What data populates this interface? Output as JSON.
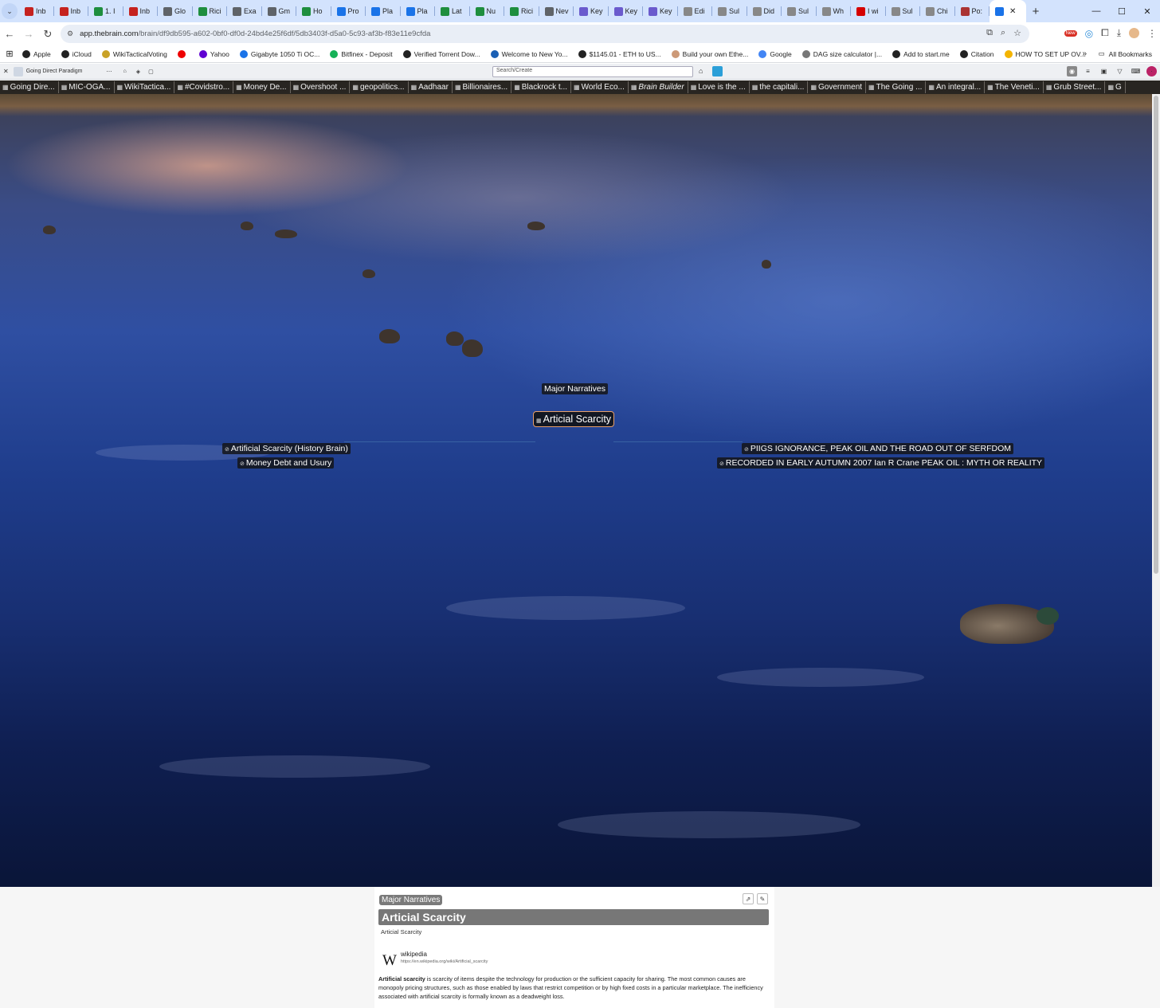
{
  "browser": {
    "tabs": [
      {
        "label": "Inb",
        "color": "#c5221f"
      },
      {
        "label": "Inb",
        "color": "#c5221f"
      },
      {
        "label": "1. I",
        "color": "#1e8e3e"
      },
      {
        "label": "Inb",
        "color": "#c5221f"
      },
      {
        "label": "Glo",
        "color": "#5f6368"
      },
      {
        "label": "Rici",
        "color": "#1e8e3e"
      },
      {
        "label": "Exa",
        "color": "#5f6368"
      },
      {
        "label": "Gm",
        "color": "#5f6368"
      },
      {
        "label": "Ho",
        "color": "#1e8e3e"
      },
      {
        "label": "Pro",
        "color": "#1a73e8"
      },
      {
        "label": "Pla",
        "color": "#1a73e8"
      },
      {
        "label": "Pla",
        "color": "#1a73e8"
      },
      {
        "label": "Lat",
        "color": "#1e8e3e"
      },
      {
        "label": "Nu",
        "color": "#1e8e3e"
      },
      {
        "label": "Rici",
        "color": "#1e8e3e"
      },
      {
        "label": "Nev",
        "color": "#5f6368"
      },
      {
        "label": "Key",
        "color": "#6a5acd"
      },
      {
        "label": "Key",
        "color": "#6a5acd"
      },
      {
        "label": "Key",
        "color": "#6a5acd"
      },
      {
        "label": "Edi",
        "color": "#888"
      },
      {
        "label": "Sul",
        "color": "#888"
      },
      {
        "label": "Did",
        "color": "#888"
      },
      {
        "label": "Sul",
        "color": "#888"
      },
      {
        "label": "Wh",
        "color": "#888"
      },
      {
        "label": "I wi",
        "color": "#d50000"
      },
      {
        "label": "Sul",
        "color": "#888"
      },
      {
        "label": "Chi",
        "color": "#888"
      },
      {
        "label": "Po:",
        "color": "#a33"
      }
    ],
    "active_tab": {
      "label": "✕"
    },
    "url": {
      "host": "app.thebrain.com",
      "path": "/brain/df9db595-a602-0bf0-df0d-24bd4e25f6df/5db3403f-d5a0-5c93-af3b-f83e11e9cfda"
    },
    "bookmarks": [
      {
        "label": "Apple",
        "color": "#222"
      },
      {
        "label": "iCloud",
        "color": "#222"
      },
      {
        "label": "WikiTacticalVoting",
        "color": "#c9a227"
      },
      {
        "label": "",
        "color": "#e00"
      },
      {
        "label": "Yahoo",
        "color": "#6001d2"
      },
      {
        "label": "Gigabyte 1050 Ti OC...",
        "color": "#1a73e8"
      },
      {
        "label": "Bitfinex - Deposit",
        "color": "#16b157"
      },
      {
        "label": "Verified Torrent Dow...",
        "color": "#222"
      },
      {
        "label": "Welcome to New Yo...",
        "color": "#1a5fb4"
      },
      {
        "label": "$1145.01 - ETH to US...",
        "color": "#222"
      },
      {
        "label": "Build your own Ethe...",
        "color": "#c97"
      },
      {
        "label": "Google",
        "color": "#4285f4"
      },
      {
        "label": "DAG size calculator |...",
        "color": "#777"
      },
      {
        "label": "Add to start.me",
        "color": "#222"
      },
      {
        "label": "Citation",
        "color": "#222"
      },
      {
        "label": "HOW TO SET UP OV...",
        "color": "#f4b400"
      }
    ],
    "bookmarks_more": "»",
    "all_bookmarks": "All Bookmarks"
  },
  "brain": {
    "current_brain": "Going Direct Paradigm",
    "search_placeholder": "Search/Create",
    "pins": [
      "Going Dire...",
      "MIC-OGA...",
      "WikiTactica...",
      "#Covidstro...",
      "Money De...",
      "Overshoot ...",
      "geopolitics...",
      "Aadhaar",
      "Billionaires...",
      "Blackrock t...",
      "World Eco...",
      "Brain Builder",
      "Love is the ...",
      "the capitali...",
      "Government",
      "The Going ...",
      "An integral...",
      "The Veneti...",
      "Grub Street...",
      "G"
    ],
    "nodes": {
      "parent": "Major Narratives",
      "active": "Articial Scarcity",
      "jump_left_1": "Artificial Scarcity (History Brain)",
      "jump_left_2": "Money Debt and Usury",
      "jump_right_1": "PIIGS IGNORANCE, PEAK OIL AND THE ROAD OUT OF SERFDOM",
      "jump_right_2": "RECORDED IN EARLY AUTUMN 2007 Ian R Crane PEAK OIL : MYTH OR REALITY"
    }
  },
  "notes": {
    "parent_pill": "Major Narratives",
    "title": "Articial Scarcity",
    "subtitle": "Articial Scarcity",
    "wiki_logo": "W",
    "wiki_name": "wikipedia",
    "wiki_url": "https://en.wikipedia.org/wiki/Artificial_scarcity",
    "term": "Artificial scarcity",
    "paragraph": " is scarcity of items despite the technology for production or the sufficient capacity for sharing. The most common causes are monopoly pricing structures, such as those enabled by laws that restrict competition or by high fixed costs in a particular marketplace. The inefficiency associated with artificial scarcity is formally known as a deadweight loss."
  }
}
